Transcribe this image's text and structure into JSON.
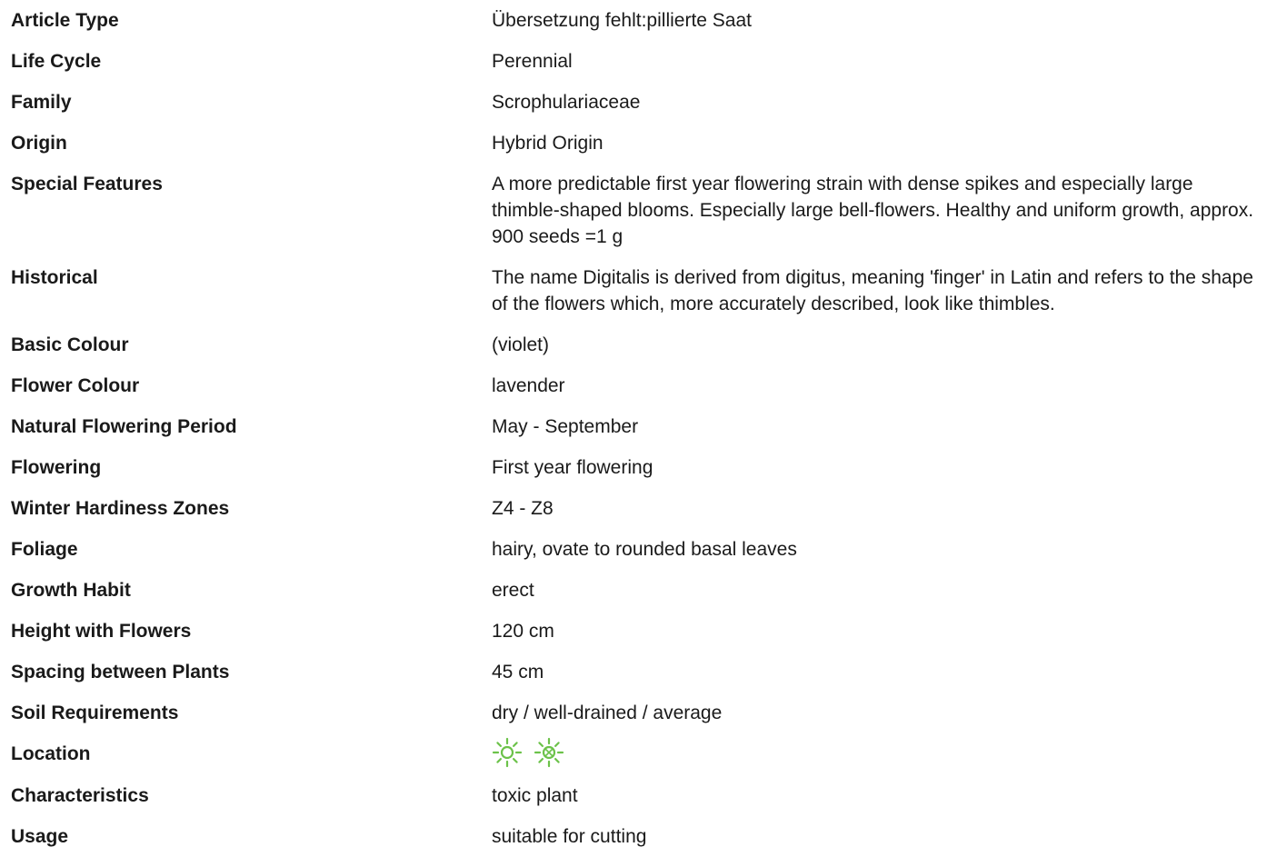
{
  "specs": [
    {
      "label": "Article Type",
      "value": "Übersetzung fehlt:pillierte Saat"
    },
    {
      "label": "Life Cycle",
      "value": "Perennial"
    },
    {
      "label": "Family",
      "value": "Scrophulariaceae"
    },
    {
      "label": "Origin",
      "value": "Hybrid Origin"
    },
    {
      "label": "Special Features",
      "value": "A more predictable first year flowering strain with dense spikes and especially large thimble-shaped blooms. Especially large bell-flowers. Healthy and uniform growth, approx. 900 seeds =1 g"
    },
    {
      "label": "Historical",
      "value": "The name Digitalis is derived from digitus, meaning 'finger' in Latin and refers to the shape of the flowers which, more accurately described, look like thimbles."
    },
    {
      "label": "Basic Colour",
      "value": "(violet)"
    },
    {
      "label": "Flower Colour",
      "value": "lavender"
    },
    {
      "label": "Natural Flowering Period",
      "value": "May - September"
    },
    {
      "label": "Flowering",
      "value": "First year flowering"
    },
    {
      "label": "Winter Hardiness Zones",
      "value": "Z4 - Z8"
    },
    {
      "label": "Foliage",
      "value": "hairy, ovate to rounded basal leaves"
    },
    {
      "label": "Growth Habit",
      "value": "erect"
    },
    {
      "label": "Height with Flowers",
      "value": "120 cm"
    },
    {
      "label": "Spacing between Plants",
      "value": "45 cm"
    },
    {
      "label": "Soil Requirements",
      "value": "dry / well-drained / average"
    },
    {
      "label": "Location",
      "icons": [
        "full-sun-icon",
        "partial-shade-icon"
      ]
    },
    {
      "label": "Characteristics",
      "value": "toxic plant"
    },
    {
      "label": "Usage",
      "value": "suitable for cutting"
    }
  ],
  "colors": {
    "icon_green": "#6cc24a"
  }
}
